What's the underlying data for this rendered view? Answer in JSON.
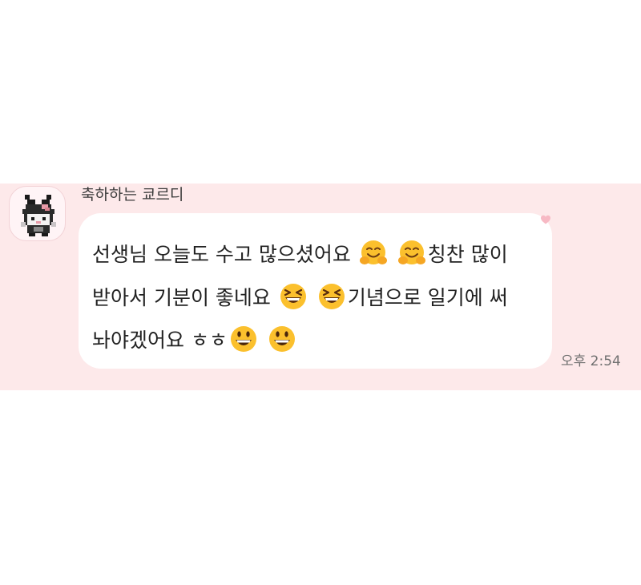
{
  "chat": {
    "sender_name": "축하하는 쿄르디",
    "message": {
      "line1_text": "선생님 오늘도 수고 많으셨어요",
      "line1_emojis": [
        "hugging-face",
        "hugging-face"
      ],
      "line1_tail": "칭찬 많이",
      "line2_text": "받아서 기분이 좋네요",
      "line2_emojis": [
        "grinning-squinting-face",
        "grinning-squinting-face"
      ],
      "line2_tail": "기념으로 일기에 써",
      "line3_text": "놔야겠어요 ㅎㅎ",
      "line3_emojis": [
        "grinning-face",
        "grinning-face"
      ]
    },
    "timestamp": "오후 2:54",
    "reaction_icon": "heart-icon"
  },
  "colors": {
    "chat_band": "#fde9ea",
    "bubble": "#ffffff",
    "heart": "#f7b9c4",
    "emoji_yellow": "#fbc02d"
  }
}
